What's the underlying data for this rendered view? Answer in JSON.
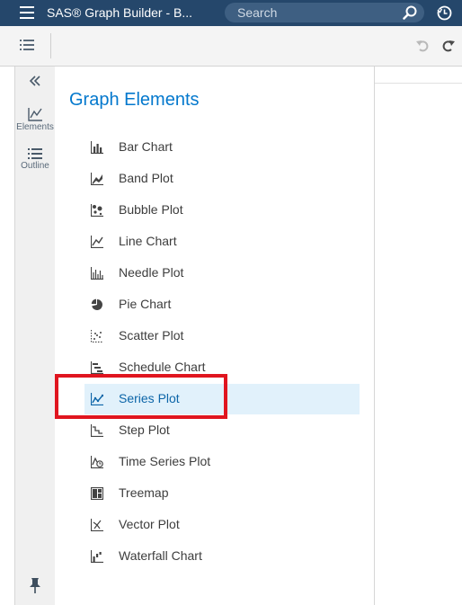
{
  "titlebar": {
    "title": "SAS® Graph Builder - B...",
    "search_placeholder": "Search"
  },
  "side_rail": {
    "items": [
      {
        "label": "Elements",
        "icon": "line-chart-icon"
      },
      {
        "label": "Outline",
        "icon": "list-icon"
      }
    ]
  },
  "panel": {
    "title": "Graph Elements",
    "elements": [
      {
        "label": "Bar Chart",
        "icon": "bar-chart-icon"
      },
      {
        "label": "Band Plot",
        "icon": "band-plot-icon"
      },
      {
        "label": "Bubble Plot",
        "icon": "bubble-plot-icon"
      },
      {
        "label": "Line Chart",
        "icon": "line-chart-icon"
      },
      {
        "label": "Needle Plot",
        "icon": "needle-plot-icon"
      },
      {
        "label": "Pie Chart",
        "icon": "pie-chart-icon"
      },
      {
        "label": "Scatter Plot",
        "icon": "scatter-plot-icon"
      },
      {
        "label": "Schedule Chart",
        "icon": "schedule-chart-icon"
      },
      {
        "label": "Series Plot",
        "icon": "series-plot-icon",
        "selected": true
      },
      {
        "label": "Step Plot",
        "icon": "step-plot-icon"
      },
      {
        "label": "Time Series Plot",
        "icon": "time-series-plot-icon"
      },
      {
        "label": "Treemap",
        "icon": "treemap-icon"
      },
      {
        "label": "Vector Plot",
        "icon": "vector-plot-icon"
      },
      {
        "label": "Waterfall Chart",
        "icon": "waterfall-chart-icon"
      }
    ]
  },
  "colors": {
    "titlebar": "#25476b",
    "accent": "#0378cd",
    "selected_bg": "#e1f1fb",
    "highlight": "#e0151f"
  }
}
